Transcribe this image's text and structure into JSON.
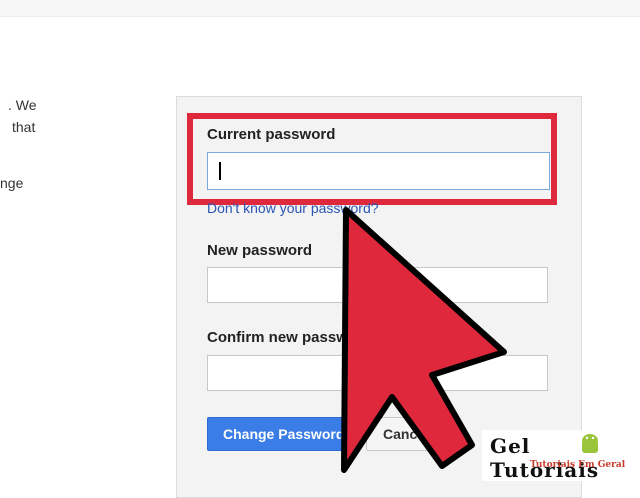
{
  "page": {
    "left_text": [
      ". We",
      "that",
      "",
      "nge"
    ]
  },
  "form": {
    "current_password_label": "Current password",
    "current_password_value": "",
    "forgot_link": "Don't know your password?",
    "new_password_label": "New password",
    "new_password_value": "",
    "confirm_password_label": "Confirm new password",
    "confirm_password_value": "",
    "change_button": "Change Password",
    "cancel_button": "Cancel"
  },
  "overlay": {
    "highlight_color": "#e0283d",
    "arrow_color": "#e0283d"
  },
  "watermark": {
    "title": "Gel Tutoriais",
    "subtitle": "Tutoriais Em Geral",
    "icon": "android-icon"
  }
}
